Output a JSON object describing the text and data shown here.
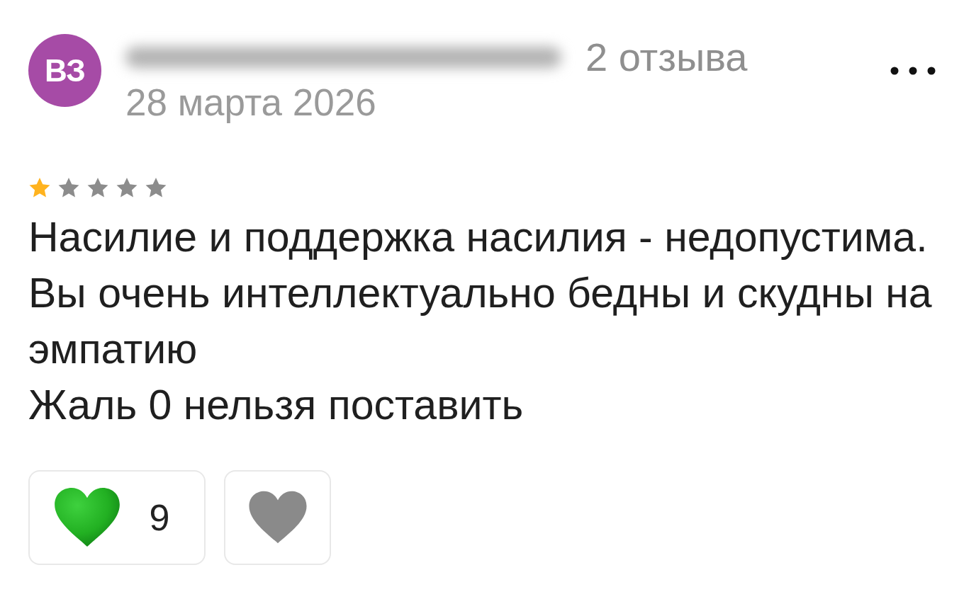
{
  "review": {
    "author_initials": "ВЗ",
    "review_count": "2 отзыва",
    "date": "28 марта 2026",
    "stars": 1,
    "text": "Насилие и поддержка насилия - недопустима.\nВы очень интеллектуально бедны и скудны на эмпатию\nЖаль 0 нельзя поставить",
    "like_count": "9"
  }
}
